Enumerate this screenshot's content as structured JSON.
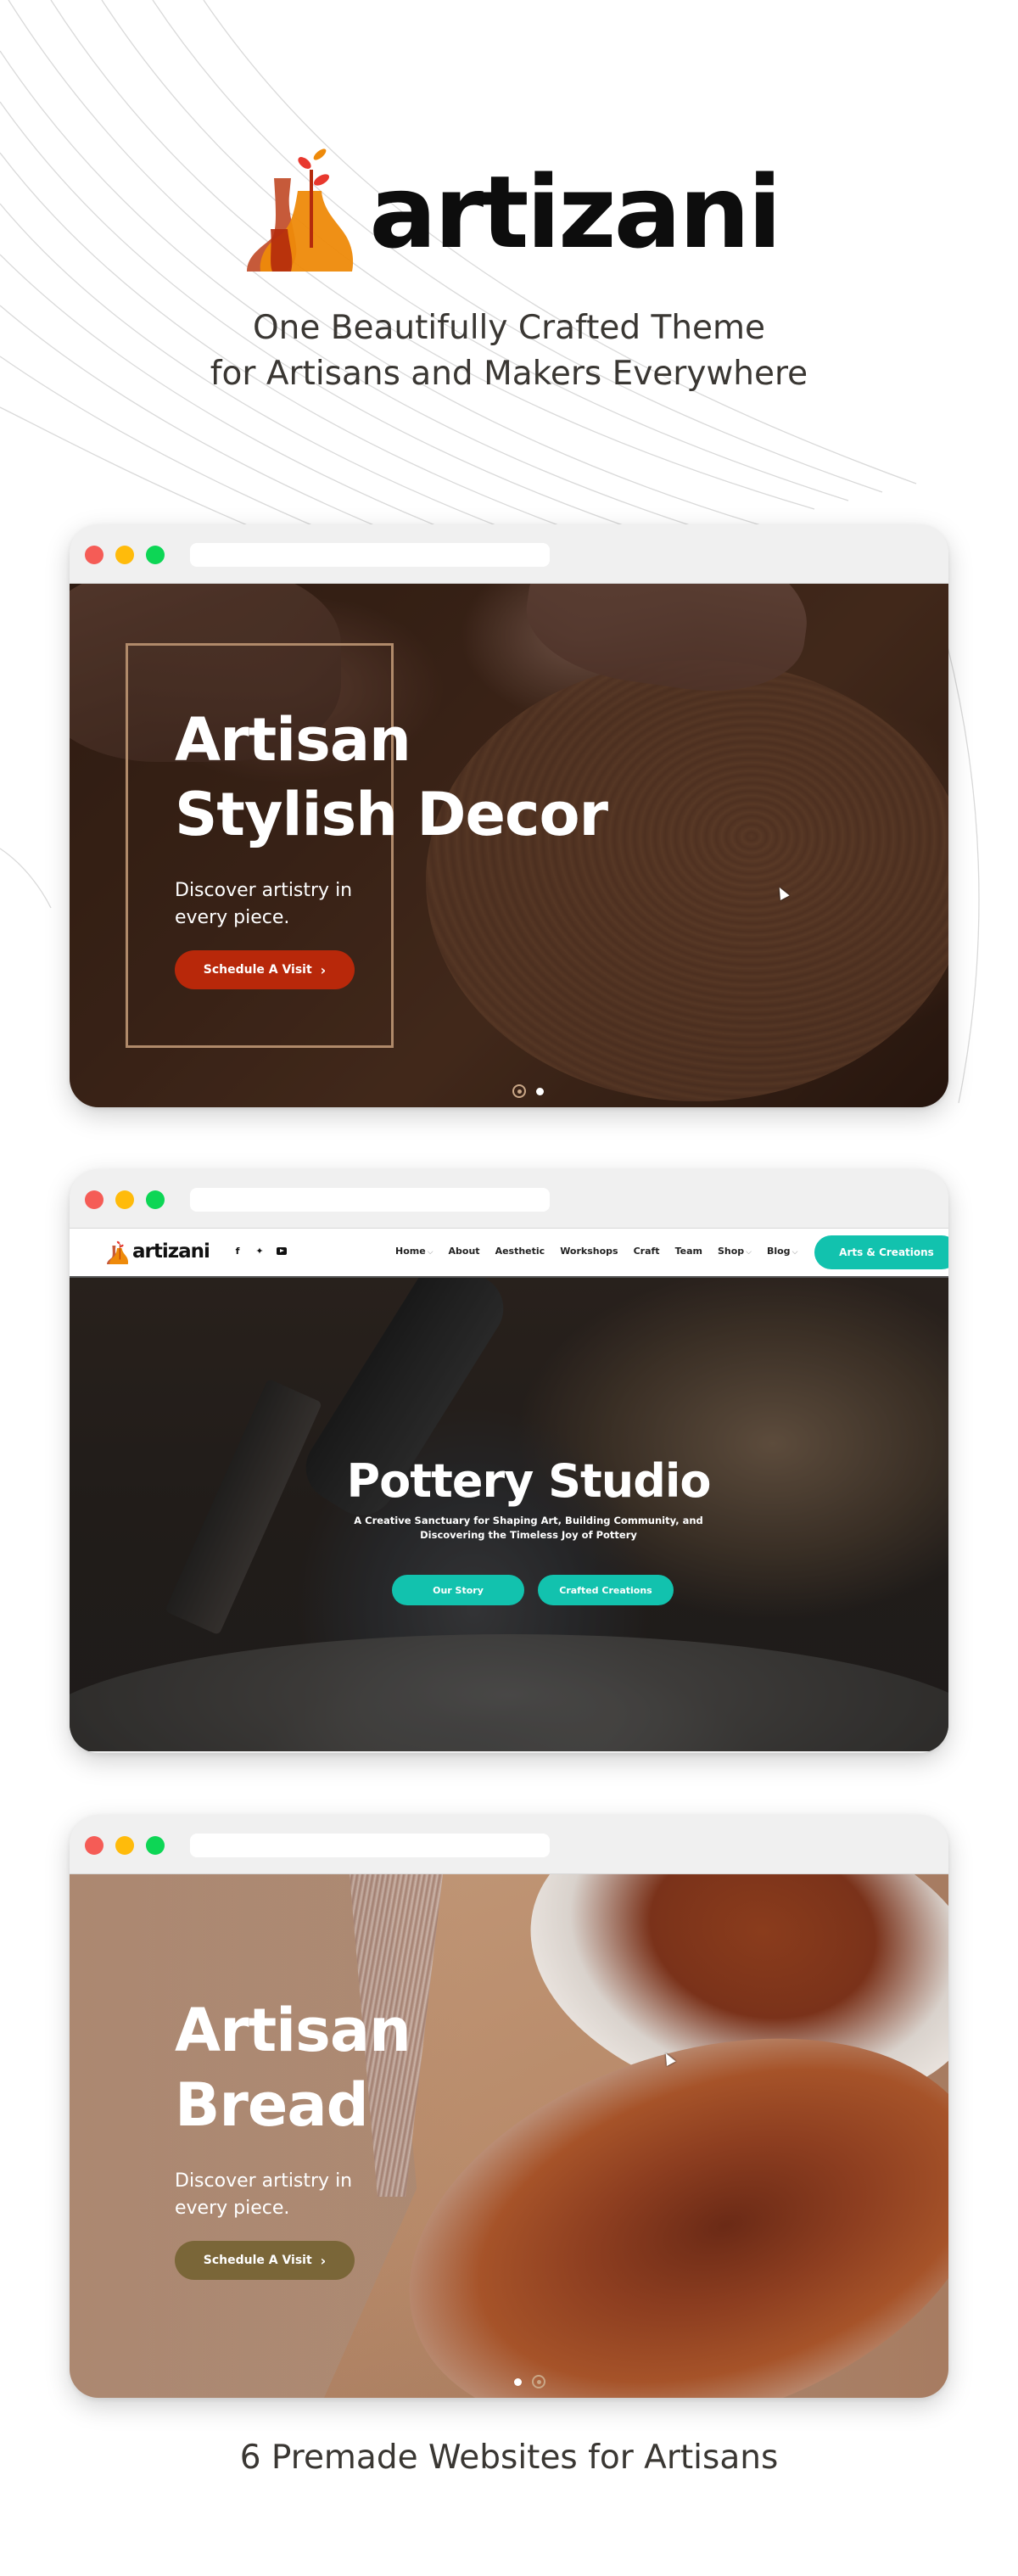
{
  "brand": {
    "name": "artizani",
    "tagline_line1": "One Beautifully Crafted Theme",
    "tagline_line2": "for Artisans and Makers Everywhere",
    "colors": {
      "vase_orange": "#ee8a0a",
      "vase_red": "#b42a0c",
      "vase_rust": "#c65a3a",
      "leaf_red": "#e8382e",
      "leaf_orange": "#ee8a0a",
      "text": "#0d0d0d"
    }
  },
  "browser": {
    "colors": {
      "close": "#f55c56",
      "minimize": "#ffbb0b",
      "maximize": "#0dd655",
      "chrome_bg": "#f0f0f0"
    }
  },
  "demos": [
    {
      "title_line1": "Artisan",
      "title_line2": "Stylish Decor",
      "subtitle_line1": "Discover artistry in",
      "subtitle_line2": "every piece.",
      "cta_label": "Schedule A Visit",
      "cta_icon": "chevron-right-icon",
      "cta_color": "#b8280a",
      "slides": {
        "total": 2,
        "active": 1
      }
    },
    {
      "nav": {
        "logo": "artizani",
        "socials": [
          "facebook-icon",
          "twitter-icon",
          "youtube-icon"
        ],
        "menu": [
          {
            "label": "Home",
            "dropdown": true
          },
          {
            "label": "About",
            "dropdown": false
          },
          {
            "label": "Aesthetic",
            "dropdown": false
          },
          {
            "label": "Workshops",
            "dropdown": false
          },
          {
            "label": "Craft",
            "dropdown": false
          },
          {
            "label": "Team",
            "dropdown": false
          },
          {
            "label": "Shop",
            "dropdown": true
          },
          {
            "label": "Blog",
            "dropdown": true
          }
        ],
        "cta_label": "Arts & Creations",
        "accent": "#12c2ae"
      },
      "title": "Pottery Studio",
      "subtitle_line1": "A Creative Sanctuary for Shaping Art, Building Community, and",
      "subtitle_line2": "Discovering the Timeless Joy of Pottery",
      "buttons": [
        "Our Story",
        "Crafted Creations"
      ]
    },
    {
      "title_line1": "Artisan",
      "title_line2": "Bread",
      "subtitle_line1": "Discover artistry in",
      "subtitle_line2": "every piece.",
      "cta_label": "Schedule A Visit",
      "cta_icon": "chevron-right-icon",
      "cta_color": "#7a6638",
      "slides": {
        "total": 2,
        "active": 2
      }
    }
  ],
  "footer": {
    "heading": "6 Premade Websites for Artisans"
  }
}
